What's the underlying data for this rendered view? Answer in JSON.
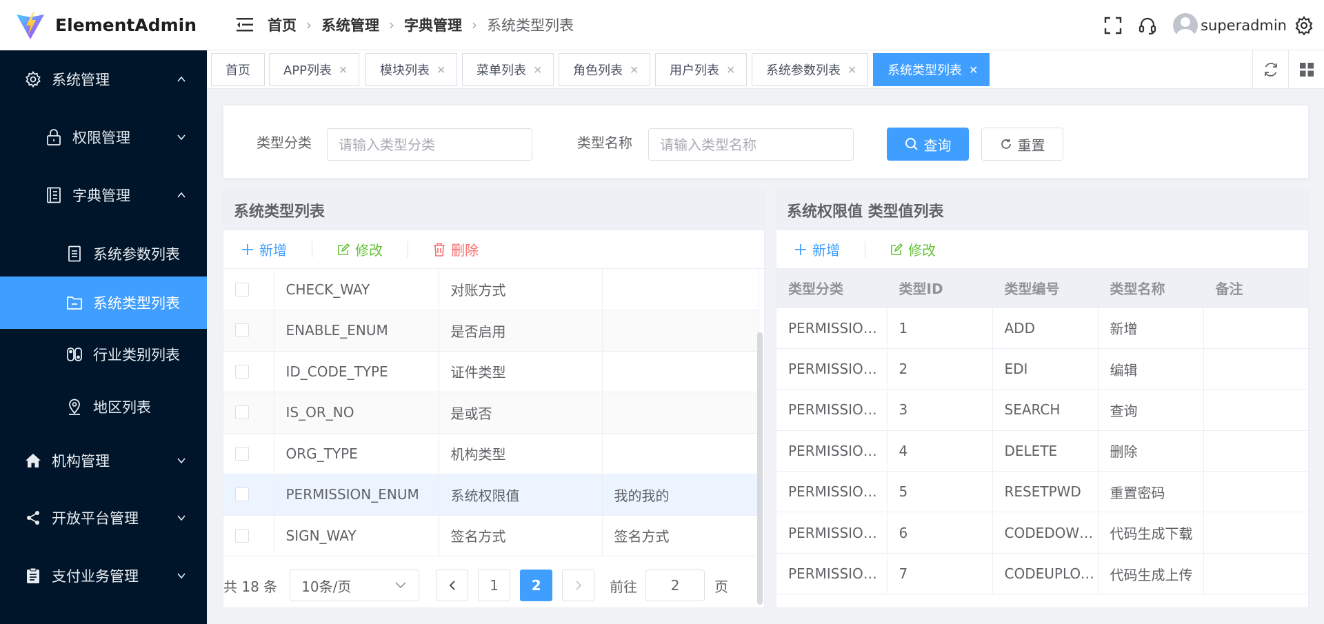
{
  "app": {
    "name": "ElementAdmin"
  },
  "breadcrumb": [
    "首页",
    "系统管理",
    "字典管理",
    "系统类型列表"
  ],
  "user": {
    "name": "superadmin"
  },
  "sidebar": {
    "items": [
      {
        "label": "系统管理",
        "icon": "gear-icon"
      },
      {
        "label": "权限管理",
        "icon": "lock-icon"
      },
      {
        "label": "字典管理",
        "icon": "book-icon"
      },
      {
        "label": "系统参数列表",
        "icon": "document-icon"
      },
      {
        "label": "系统类型列表",
        "icon": "folder-icon"
      },
      {
        "label": "行业类别列表",
        "icon": "switch-icon"
      },
      {
        "label": "地区列表",
        "icon": "location-icon"
      },
      {
        "label": "机构管理",
        "icon": "home-icon"
      },
      {
        "label": "开放平台管理",
        "icon": "share-icon"
      },
      {
        "label": "支付业务管理",
        "icon": "clipboard-icon"
      }
    ]
  },
  "tabs": [
    "首页",
    "APP列表",
    "模块列表",
    "菜单列表",
    "角色列表",
    "用户列表",
    "系统参数列表",
    "系统类型列表"
  ],
  "search": {
    "type_category_label": "类型分类",
    "type_category_placeholder": "请输入类型分类",
    "type_name_label": "类型名称",
    "type_name_placeholder": "请输入类型名称",
    "query_label": "查询",
    "reset_label": "重置"
  },
  "left_panel": {
    "title": "系统类型列表",
    "add_label": "新增",
    "edit_label": "修改",
    "delete_label": "删除",
    "rows": [
      [
        "CHECK_WAY",
        "对账方式",
        ""
      ],
      [
        "ENABLE_ENUM",
        "是否启用",
        ""
      ],
      [
        "ID_CODE_TYPE",
        "证件类型",
        ""
      ],
      [
        "IS_OR_NO",
        "是或否",
        ""
      ],
      [
        "ORG_TYPE",
        "机构类型",
        ""
      ],
      [
        "PERMISSION_ENUM",
        "系统权限值",
        "我的我的"
      ],
      [
        "SIGN_WAY",
        "签名方式",
        "签名方式"
      ]
    ],
    "pagination": {
      "total": "共 18 条",
      "page_size": "10条/页",
      "pages": [
        "1",
        "2"
      ],
      "goto_label": "前往",
      "goto_value": "2",
      "page_unit": "页"
    }
  },
  "right_panel": {
    "title": "系统权限值  类型值列表",
    "add_label": "新增",
    "edit_label": "修改",
    "columns": [
      "类型分类",
      "类型ID",
      "类型编号",
      "类型名称",
      "备注"
    ],
    "rows": [
      [
        "PERMISSION_ENUM",
        "1",
        "ADD",
        "新增",
        ""
      ],
      [
        "PERMISSION_ENUM",
        "2",
        "EDI",
        "编辑",
        ""
      ],
      [
        "PERMISSION_ENUM",
        "3",
        "SEARCH",
        "查询",
        ""
      ],
      [
        "PERMISSION_ENUM",
        "4",
        "DELETE",
        "删除",
        ""
      ],
      [
        "PERMISSION_ENUM",
        "5",
        "RESETPWD",
        "重置密码",
        ""
      ],
      [
        "PERMISSION_ENUM",
        "6",
        "CODEDOWNLOAD",
        "代码生成下载",
        ""
      ],
      [
        "PERMISSION_ENUM",
        "7",
        "CODEUPLOAD",
        "代码生成上传",
        ""
      ]
    ]
  },
  "colors": {
    "sidebar_bg": "#001529",
    "accent": "#409eff",
    "success": "#67c23a",
    "danger": "#f56c6c"
  }
}
